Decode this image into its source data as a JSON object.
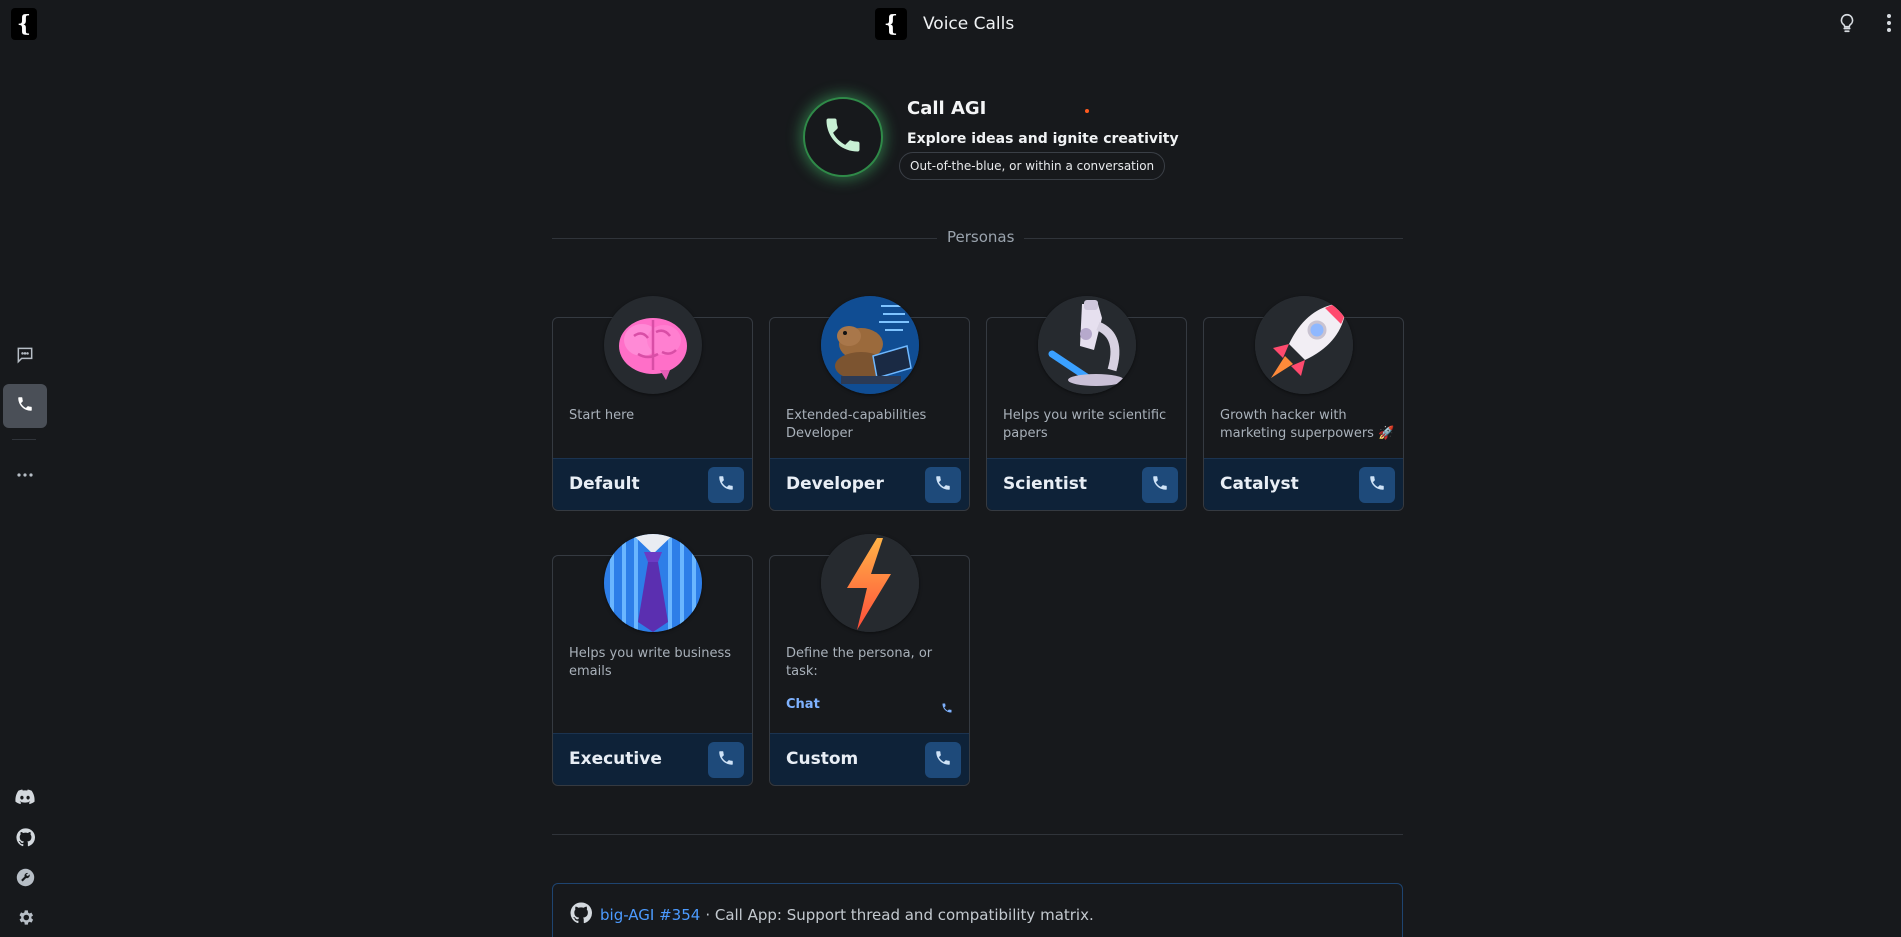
{
  "app": {
    "logo_glyph": "{",
    "page_title": "Voice Calls",
    "icons": [
      "lightbulb-icon",
      "more-vertical-icon"
    ]
  },
  "sidebar": {
    "items": [
      {
        "name": "chat",
        "icon": "chat-bubble-icon",
        "active": false
      },
      {
        "name": "call",
        "icon": "phone-icon",
        "active": true
      },
      {
        "name": "more",
        "icon": "more-horizontal-icon",
        "active": false
      }
    ],
    "bottom": [
      {
        "name": "discord",
        "icon": "discord-icon"
      },
      {
        "name": "github",
        "icon": "github-icon"
      },
      {
        "name": "tools",
        "icon": "wrench-icon"
      },
      {
        "name": "settings",
        "icon": "gear-icon"
      }
    ]
  },
  "hero": {
    "title": "Call AGI",
    "subtitle": "Explore ideas and ignite creativity",
    "chip": "Out-of-the-blue, or within a conversation"
  },
  "personas": {
    "section_label": "Personas",
    "cards": [
      {
        "name": "Default",
        "description": "Start here",
        "avatar": "brain"
      },
      {
        "name": "Developer",
        "description": "Extended-capabilities Developer",
        "avatar": "capybara-developer"
      },
      {
        "name": "Scientist",
        "description": "Helps you write scientific papers",
        "avatar": "microscope"
      },
      {
        "name": "Catalyst",
        "description": "Growth hacker with marketing superpowers 🚀",
        "avatar": "rocket"
      },
      {
        "name": "Executive",
        "description": "Helps you write business emails",
        "avatar": "necktie"
      },
      {
        "name": "Custom",
        "description": "Define the persona, or task:",
        "avatar": "lightning",
        "chat_label": "Chat"
      }
    ]
  },
  "footer": {
    "issue_link": "big-AGI #354",
    "issue_text": "· Call App: Support thread and compatibility matrix."
  },
  "colors": {
    "background": "#17191c",
    "card_footer": "#0e2238",
    "call_button": "#1e4a7a",
    "hero_glow": "#48c86e",
    "link": "#4c9bff"
  }
}
